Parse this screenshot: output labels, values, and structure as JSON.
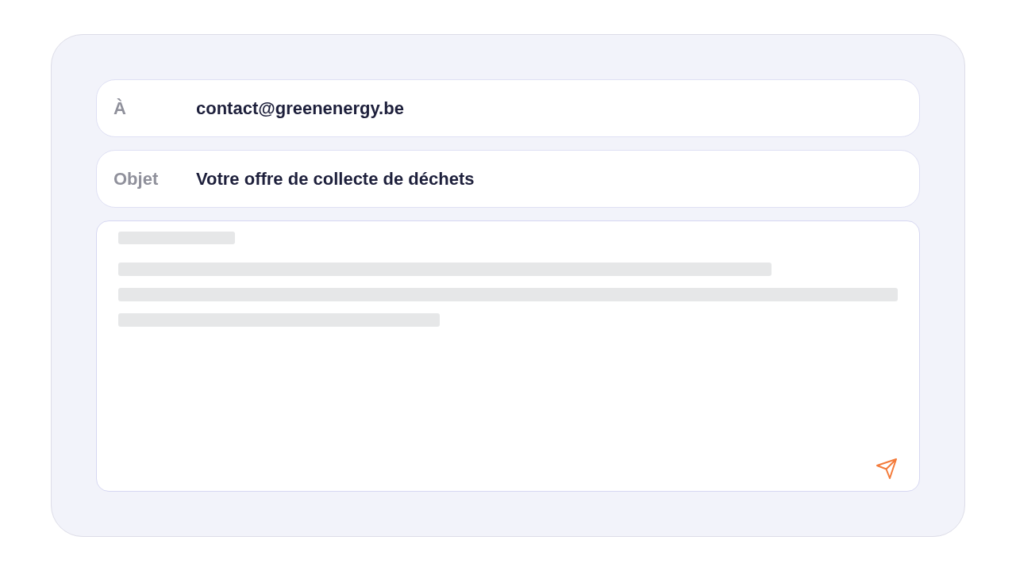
{
  "fields": [
    {
      "label": "À",
      "value": "contact@greenenergy.be"
    },
    {
      "label": "Objet",
      "value": "Votre offre de collecte de déchets"
    }
  ]
}
